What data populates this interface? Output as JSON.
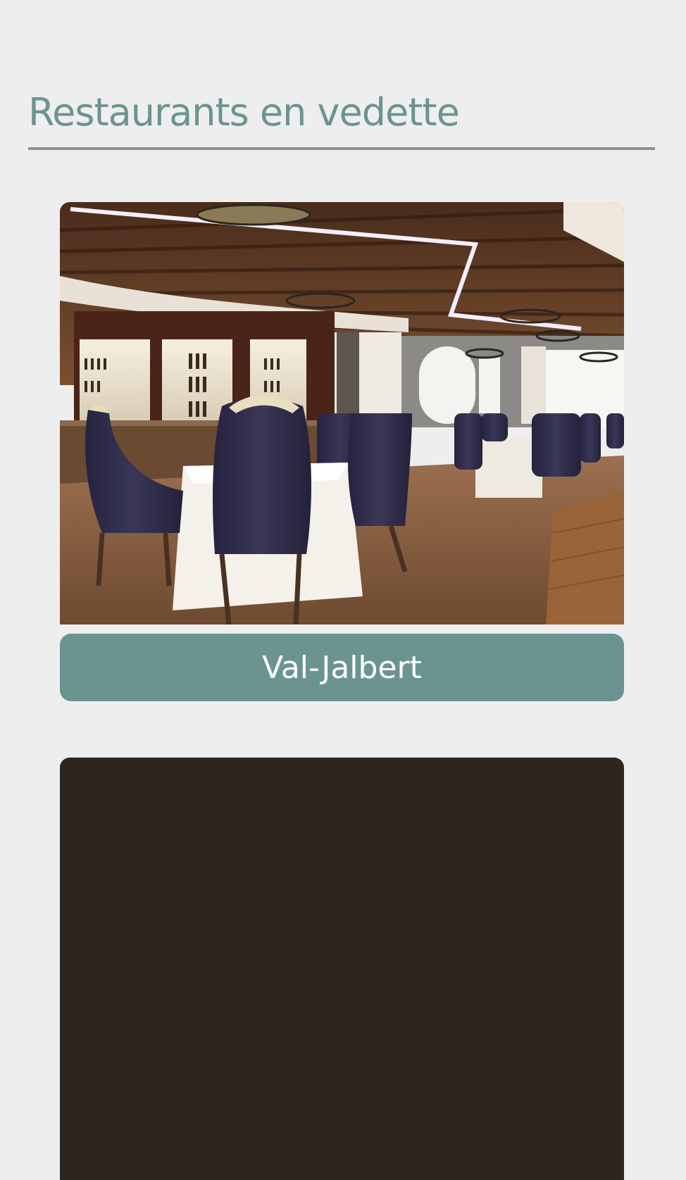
{
  "section": {
    "title": "Restaurants en vedette"
  },
  "restaurants": [
    {
      "name": "Val-Jalbert",
      "image": "restaurant-dining-room-photo"
    },
    {
      "name": "",
      "image": "restaurant-photo"
    }
  ],
  "colors": {
    "background": "#eeeeee",
    "accent": "#6b9490",
    "rule": "#8f8f8f",
    "button_text": "#ffffff"
  }
}
